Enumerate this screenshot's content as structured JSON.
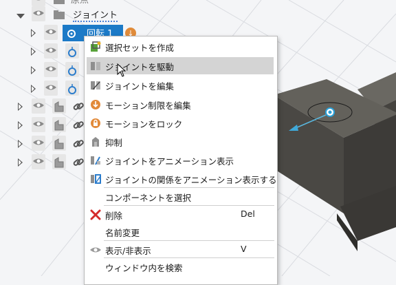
{
  "tree": {
    "top_folder_label": "原点",
    "joints_folder_label": "ジョイント",
    "selected_joint_label": "回転 1"
  },
  "menu": {
    "items": [
      {
        "label": "選択セットを作成",
        "icon": "selection-set-icon"
      },
      {
        "label": "ジョイントを駆動",
        "icon": "drive-joint-icon"
      },
      {
        "label": "ジョイントを編集",
        "icon": "edit-joint-icon"
      },
      {
        "label": "モーション制限を編集",
        "icon": "motion-limit-icon"
      },
      {
        "label": "モーションをロック",
        "icon": "lock-icon"
      },
      {
        "label": "抑制",
        "icon": "suppress-icon"
      },
      {
        "label": "ジョイントをアニメーション表示",
        "icon": "animate-joint-icon"
      },
      {
        "label": "ジョイントの関係をアニメーション表示する",
        "icon": "animate-relationship-icon"
      },
      {
        "label": "コンポーネントを選択",
        "icon": ""
      },
      {
        "label": "削除",
        "shortcut": "Del",
        "icon": "delete-icon"
      },
      {
        "label": "名前変更",
        "icon": ""
      },
      {
        "label": "表示/非表示",
        "shortcut": "V",
        "icon": "eye-icon"
      },
      {
        "label": "ウィンドウ内を検索",
        "icon": ""
      }
    ]
  },
  "colors": {
    "accent": "#1c7ac7",
    "model_top": "#62605a",
    "model_side": "#3f3d39",
    "highlight": "#d4d4d4"
  }
}
